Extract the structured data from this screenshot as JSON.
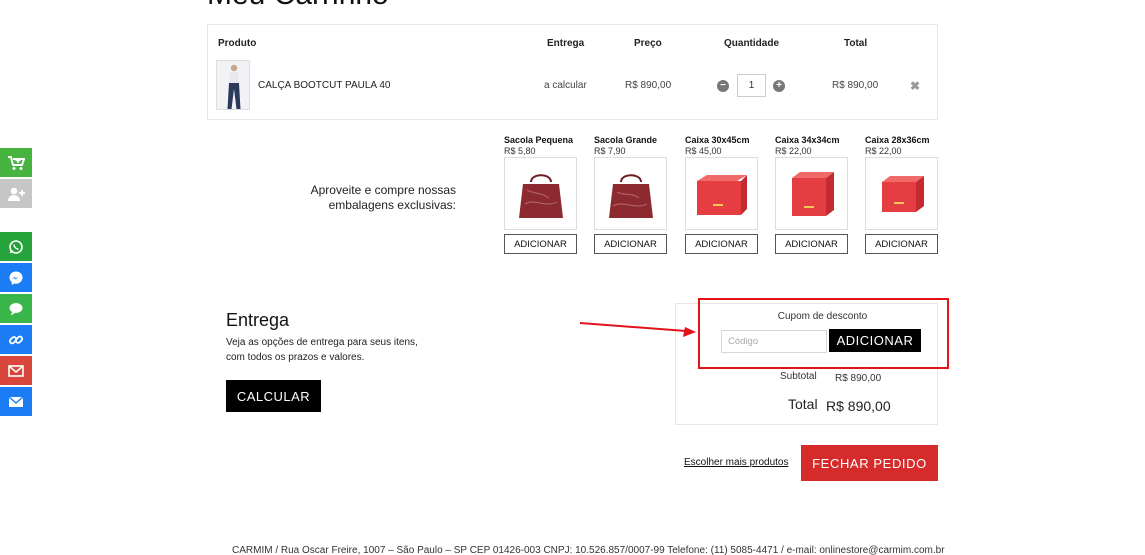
{
  "page": {
    "title": "Meu Carrinho"
  },
  "sidebar": {
    "items": [
      {
        "icon": "cart-plus-icon",
        "color": "#46b43f"
      },
      {
        "icon": "add-user-icon",
        "color": "#c6c6c6"
      },
      {
        "icon": "whatsapp-icon",
        "color": "#26a33a"
      },
      {
        "icon": "messenger-icon",
        "color": "#1b7cf5"
      },
      {
        "icon": "chat-bubble-icon",
        "color": "#3ab54a"
      },
      {
        "icon": "link-icon",
        "color": "#1b7cf5"
      },
      {
        "icon": "mail-icon",
        "color": "#d9473c"
      },
      {
        "icon": "envelope-icon",
        "color": "#1b7cf5"
      }
    ]
  },
  "cart": {
    "headers": {
      "product": "Produto",
      "delivery": "Entrega",
      "price": "Preço",
      "quantity": "Quantidade",
      "total": "Total"
    },
    "items": [
      {
        "name": "CALÇA BOOTCUT PAULA 40",
        "delivery": "a calcular",
        "price": "R$ 890,00",
        "quantity": "1",
        "total": "R$ 890,00"
      }
    ]
  },
  "packaging": {
    "text": "Aproveite e compre nossas embalagens exclusivas:",
    "items": [
      {
        "name": "Sacola Pequena",
        "price": "R$ 5,80",
        "button": "ADICIONAR",
        "kind": "bag"
      },
      {
        "name": "Sacola Grande",
        "price": "R$ 7,90",
        "button": "ADICIONAR",
        "kind": "bag"
      },
      {
        "name": "Caixa 30x45cm",
        "price": "R$ 45,00",
        "button": "ADICIONAR",
        "kind": "box"
      },
      {
        "name": "Caixa 34x34cm",
        "price": "R$ 22,00",
        "button": "ADICIONAR",
        "kind": "box"
      },
      {
        "name": "Caixa 28x36cm",
        "price": "R$ 22,00",
        "button": "ADICIONAR",
        "kind": "box"
      }
    ]
  },
  "delivery": {
    "title": "Entrega",
    "description": "Veja as opções de entrega para seus itens, com todos os prazos e valores.",
    "button": "CALCULAR"
  },
  "coupon": {
    "label": "Cupom de desconto",
    "placeholder": "Código",
    "button": "ADICIONAR"
  },
  "summary": {
    "subtotal_label": "Subtotal",
    "subtotal_value": "R$ 890,00",
    "total_label": "Total",
    "total_value": "R$ 890,00"
  },
  "actions": {
    "continue": "Escolher mais produtos",
    "checkout": "FECHAR PEDIDO"
  },
  "footer": {
    "text": "CARMIM / Rua Oscar Freire, 1007 – São Paulo – SP CEP 01426-003 CNPJ: 10.526.857/0007-99 Telefone: (11) 5085-4471 / e-mail: onlinestore@carmim.com.br"
  },
  "colors": {
    "accent_red": "#d52b2b",
    "highlight": "#e0141a",
    "dark": "#000000"
  }
}
